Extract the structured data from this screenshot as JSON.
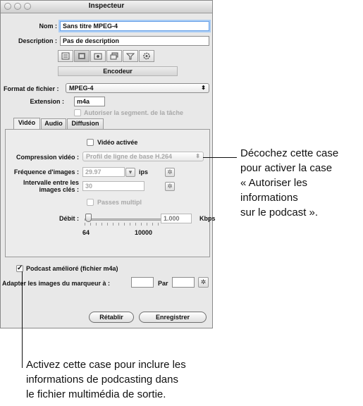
{
  "window": {
    "title": "Inspecteur"
  },
  "nom": {
    "label": "Nom :",
    "value": "Sans titre MPEG-4"
  },
  "description": {
    "label": "Description :",
    "value": "Pas de description"
  },
  "toolbar": {
    "icons": [
      "list-icon",
      "film-icon",
      "photo-icon",
      "layers-icon",
      "filter-icon",
      "gear-icon"
    ],
    "active_index": 1
  },
  "encoder_panel": {
    "label": "Encodeur"
  },
  "format": {
    "label": "Format de fichier :",
    "value": "MPEG-4"
  },
  "extension": {
    "label": "Extension :",
    "value": "m4a"
  },
  "segmentation": {
    "label": "Autoriser la segment. de la tâche",
    "checked": false
  },
  "tabs": [
    {
      "label": "Vidéo",
      "active": true
    },
    {
      "label": "Audio",
      "active": false
    },
    {
      "label": "Diffusion",
      "active": false
    }
  ],
  "video": {
    "enabled": {
      "label": "Vidéo activée",
      "checked": false
    },
    "compression": {
      "label": "Compression vidéo :",
      "value": "Profil de ligne de base H.264"
    },
    "frame_rate": {
      "label": "Fréquence d'images :",
      "value": "29.97",
      "unit": "ips"
    },
    "keyframe": {
      "label_line1": "Intervalle entre les",
      "label_line2": "images clés :",
      "value": "30"
    },
    "multipass": {
      "label": "Passes multipl",
      "checked": false
    },
    "bitrate": {
      "label": "Débit :",
      "value": "1.000",
      "unit": "Kbps",
      "min": "64",
      "max": "10000",
      "slider_fraction": 0.01
    }
  },
  "podcast": {
    "label": "Podcast amélioré (fichier m4a)",
    "checked": true
  },
  "adapt": {
    "label": "Adapter les images du marqueur à :",
    "par_label": "Par"
  },
  "buttons": {
    "revert": "Rétablir",
    "save": "Enregistrer"
  },
  "callouts": {
    "right": [
      "Décochez cette case",
      "pour activer la case",
      "« Autoriser les",
      "informations",
      "sur le podcast »."
    ],
    "bottom": [
      "Activez cette case pour inclure les",
      "informations de podcasting dans",
      "le fichier multimédia de sortie."
    ]
  }
}
